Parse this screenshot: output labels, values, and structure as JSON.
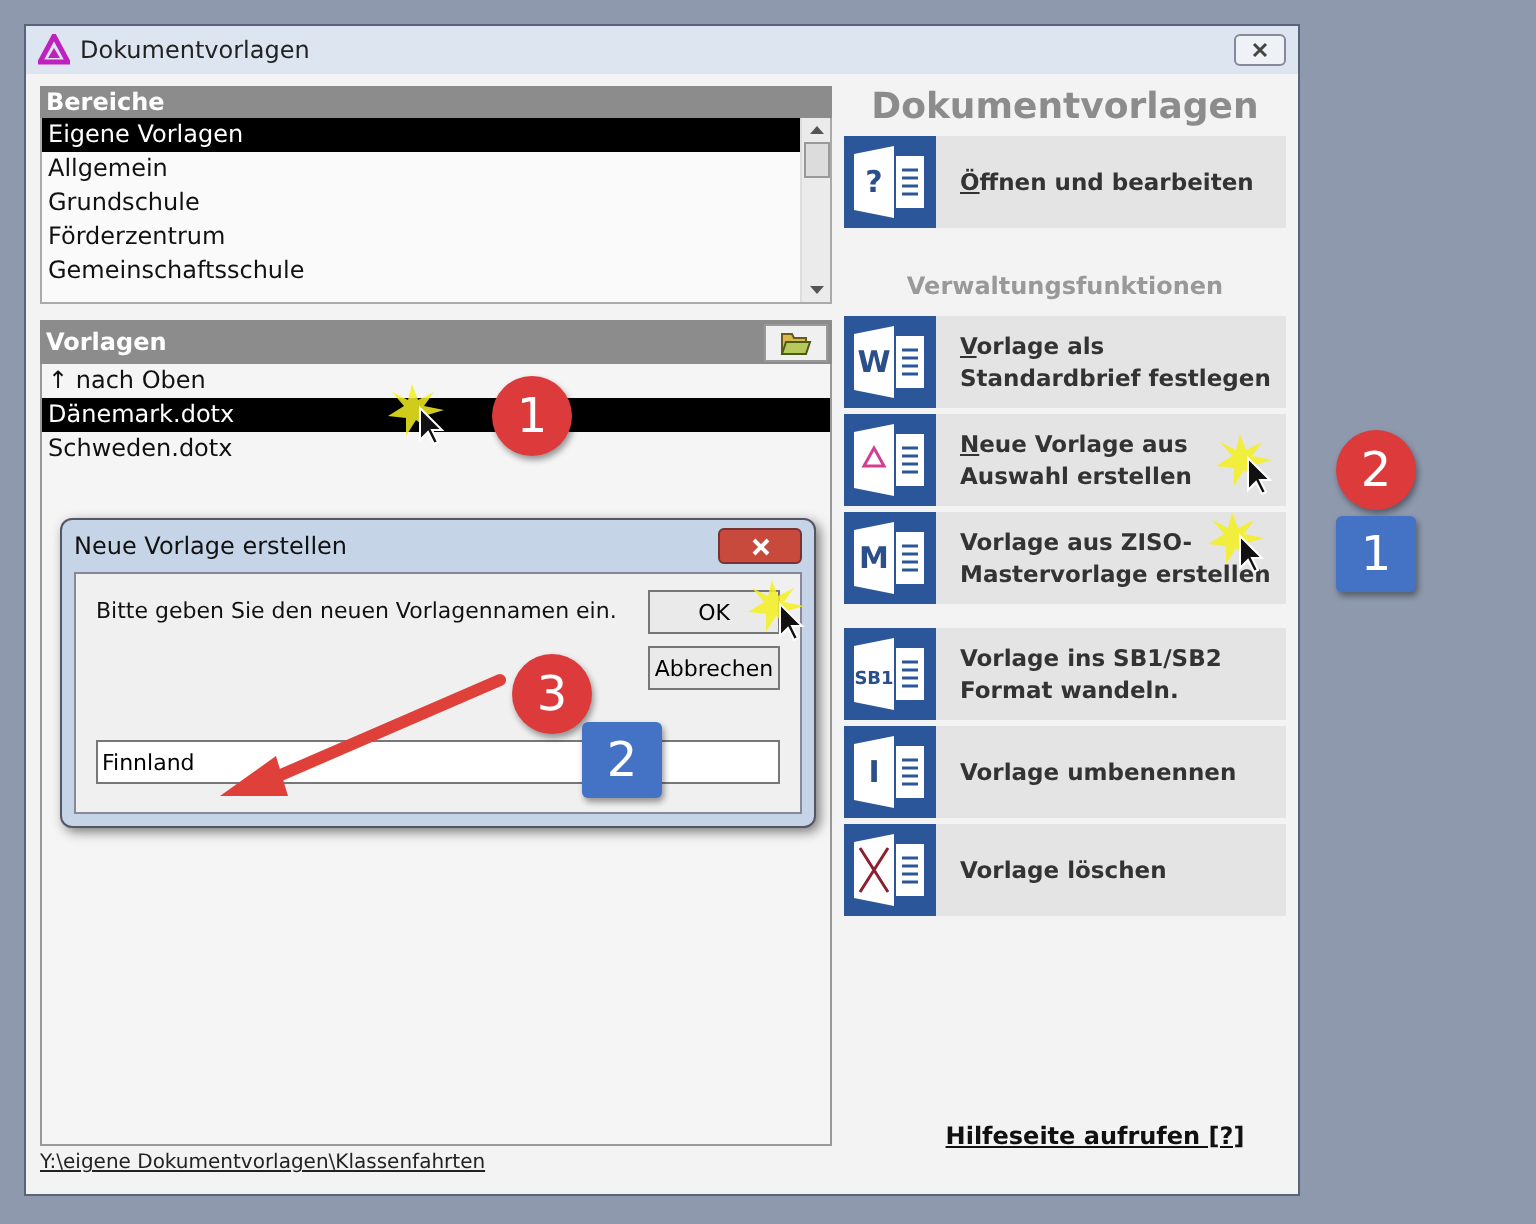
{
  "window": {
    "title": "Dokumentvorlagen"
  },
  "bereiche": {
    "header": "Bereiche",
    "items": [
      {
        "label": "Eigene Vorlagen",
        "selected": true
      },
      {
        "label": "Allgemein",
        "selected": false
      },
      {
        "label": "Grundschule",
        "selected": false
      },
      {
        "label": "Förderzentrum",
        "selected": false
      },
      {
        "label": "Gemeinschaftsschule",
        "selected": false
      }
    ]
  },
  "vorlagen": {
    "header": "Vorlagen",
    "items": [
      {
        "label": "↑ nach Oben",
        "selected": false
      },
      {
        "label": "Dänemark.dotx",
        "selected": true
      },
      {
        "label": "Schweden.dotx",
        "selected": false
      }
    ]
  },
  "path": "Y:\\eigene Dokumentvorlagen\\Klassenfahrten",
  "panel_title": "Dokumentvorlagen",
  "main_action": {
    "label": "Öffnen und bearbeiten",
    "mnemonic": true,
    "icon": {
      "kind": "letter",
      "text": "?"
    }
  },
  "section_label": "Verwaltungsfunktionen",
  "action_groups": [
    [
      {
        "label": "Vorlage als Standardbrief festlegen",
        "mnemonic": true,
        "icon": {
          "kind": "letter",
          "text": "W"
        }
      },
      {
        "label": "Neue Vorlage aus Auswahl erstellen",
        "mnemonic": true,
        "icon": {
          "kind": "logo"
        }
      },
      {
        "label": "Vorlage aus ZISO-Mastervorlage erstellen",
        "mnemonic": false,
        "icon": {
          "kind": "letter",
          "text": "M"
        }
      }
    ],
    [
      {
        "label": "Vorlage ins SB1/SB2 Format wandeln.",
        "mnemonic": false,
        "icon": {
          "kind": "letter",
          "text": "SB1"
        }
      },
      {
        "label": "Vorlage umbenennen",
        "mnemonic": false,
        "icon": {
          "kind": "letter",
          "text": "I"
        }
      },
      {
        "label": "Vorlage löschen",
        "mnemonic": false,
        "icon": {
          "kind": "cross"
        }
      }
    ]
  ],
  "help_link": "Hilfeseite aufrufen [?]",
  "dialog": {
    "title": "Neue Vorlage erstellen",
    "message": "Bitte geben Sie den neuen Vorlagennamen ein.",
    "ok": "OK",
    "cancel": "Abbrechen",
    "value": "Finnland"
  },
  "annotations": [
    {
      "kind": "circle",
      "text": "1"
    },
    {
      "kind": "circle",
      "text": "2"
    },
    {
      "kind": "square",
      "text": "1"
    },
    {
      "kind": "circle",
      "text": "3"
    },
    {
      "kind": "square",
      "text": "2"
    }
  ]
}
